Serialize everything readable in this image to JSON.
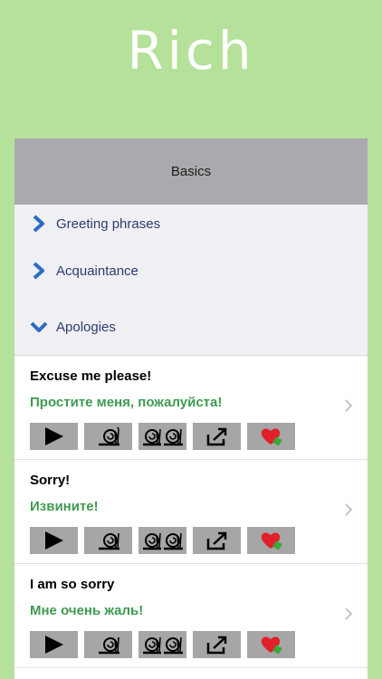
{
  "hero": {
    "title": "Rich"
  },
  "section": {
    "title": "Basics"
  },
  "categories": [
    {
      "label": "Greeting phrases",
      "state": "collapsed"
    },
    {
      "label": "Acquaintance",
      "state": "collapsed"
    },
    {
      "label": "Apologies",
      "state": "expanded"
    }
  ],
  "phrases": [
    {
      "english": "Excuse me please!",
      "russian": "Простите меня, пожалуйста!"
    },
    {
      "english": "Sorry!",
      "russian": "Извините!"
    },
    {
      "english": "I am so sorry",
      "russian": "Мне очень жаль!"
    }
  ],
  "actions": [
    "play-icon",
    "slow-snail-icon",
    "very-slow-snails-icon",
    "share-icon",
    "favorite-heart-icon"
  ],
  "colors": {
    "background": "#b5e19b",
    "header": "#a9a9ae",
    "category_text": "#2d3d6e",
    "russian_text": "#3f9a52",
    "button": "#a6a6a6",
    "chevron": "#2b6cc4",
    "heart": "#e0202a",
    "clover": "#3aa63a"
  }
}
